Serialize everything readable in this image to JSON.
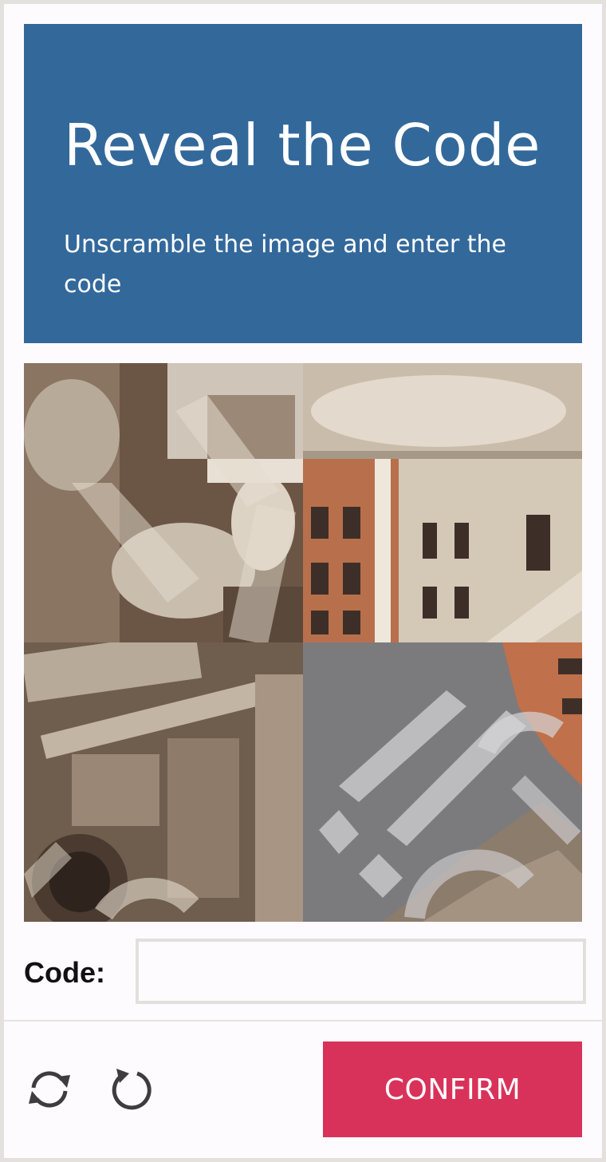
{
  "header": {
    "title": "Reveal the Code",
    "subtitle": "Unscramble the image and enter the code",
    "background_color": "#33689b"
  },
  "puzzle": {
    "tiles": [
      {
        "name": "puzzle-tile-top-left",
        "content": "fountain-statues-icon"
      },
      {
        "name": "puzzle-tile-top-right",
        "content": "building-facade-icon"
      },
      {
        "name": "puzzle-tile-bottom-left",
        "content": "ornate-columns-icon"
      },
      {
        "name": "puzzle-tile-bottom-right",
        "content": "sky-rooftops-icon"
      }
    ]
  },
  "form": {
    "code_label": "Code:",
    "code_value": "",
    "code_placeholder": ""
  },
  "footer": {
    "refresh_icon": "refresh-icon",
    "rotate_icon": "rotate-icon",
    "confirm_label": "CONFIRM",
    "confirm_color": "#d9325a"
  }
}
